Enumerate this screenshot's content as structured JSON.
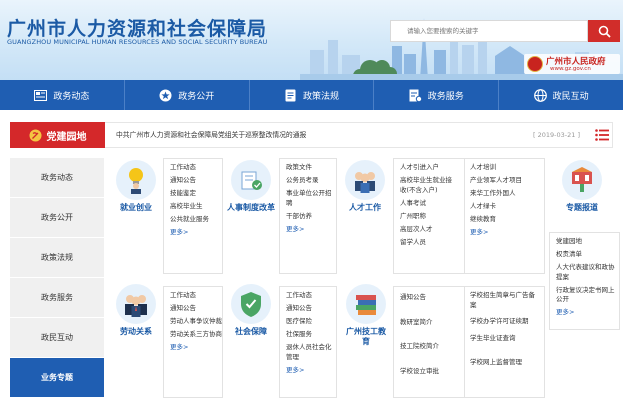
{
  "header": {
    "title": "广州市人力资源和社会保障局",
    "subtitle": "GUANGZHOU MUNICIPAL HUMAN RESOURCES AND SOCIAL SECURITY BUREAU",
    "search_placeholder": "请输入您要搜索的关键字",
    "gov_logo_title": "广州市人民政府",
    "gov_logo_url": "www.gz.gov.cn"
  },
  "nav": [
    "政务动态",
    "政务公开",
    "政策法规",
    "政务服务",
    "政民互动"
  ],
  "notice": {
    "tag": "党建园地",
    "text": "中共广州市人力资源和社会保障局党组关于巡察整改情况的通报",
    "date": "[ 2019-03-21 ]"
  },
  "sidebar": [
    "政务动态",
    "政务公开",
    "政策法规",
    "政务服务",
    "政民互动",
    "业务专题"
  ],
  "categories": {
    "c1": {
      "label": "就业创业",
      "links": [
        "工作动态",
        "通知公告",
        "技能鉴定",
        "高校毕业生",
        "公共就业服务"
      ],
      "more": "更多>"
    },
    "c2": {
      "label": "人事制度改革",
      "links": [
        "政策文件",
        "公务员考录",
        "事业单位公开招聘",
        "干部仿养"
      ],
      "more": "更多>"
    },
    "c3": {
      "label": "人才工作",
      "links_a": [
        "人才引进入户",
        "高校毕业生就业接收(不含入户)",
        "人事考试",
        "广州职称",
        "高层次人才",
        "留学人员"
      ],
      "links_b": [
        "人才培训",
        "产业领军人才项目",
        "来华工作外国人",
        "人才绿卡",
        "继续教育"
      ],
      "more": "更多>"
    },
    "c4": {
      "label": "专题报道",
      "links": [
        "党建园地",
        "权责清单",
        "人大代表建议和政协提案",
        "行政复议决定书网上公开"
      ],
      "more": "更多>"
    },
    "c5": {
      "label": "劳动关系",
      "links": [
        "工作动态",
        "通知公告",
        "劳动人事争议仲裁",
        "劳动关系三方协商"
      ],
      "more": "更多>"
    },
    "c6": {
      "label": "社会保障",
      "links": [
        "工作动态",
        "通知公告",
        "医疗保险",
        "社保服务",
        "退休人员社会化管理"
      ],
      "more": "更多>"
    },
    "c7": {
      "label": "广州技工教育",
      "links_a": [
        "通知公告",
        "教研室简介",
        "技工院校简介",
        "学校设立审批"
      ],
      "links_b": [
        "学校招生简章与广告备案",
        "学校办学许可证续期",
        "学生毕业证查询",
        "学校网上监督管理"
      ]
    }
  }
}
